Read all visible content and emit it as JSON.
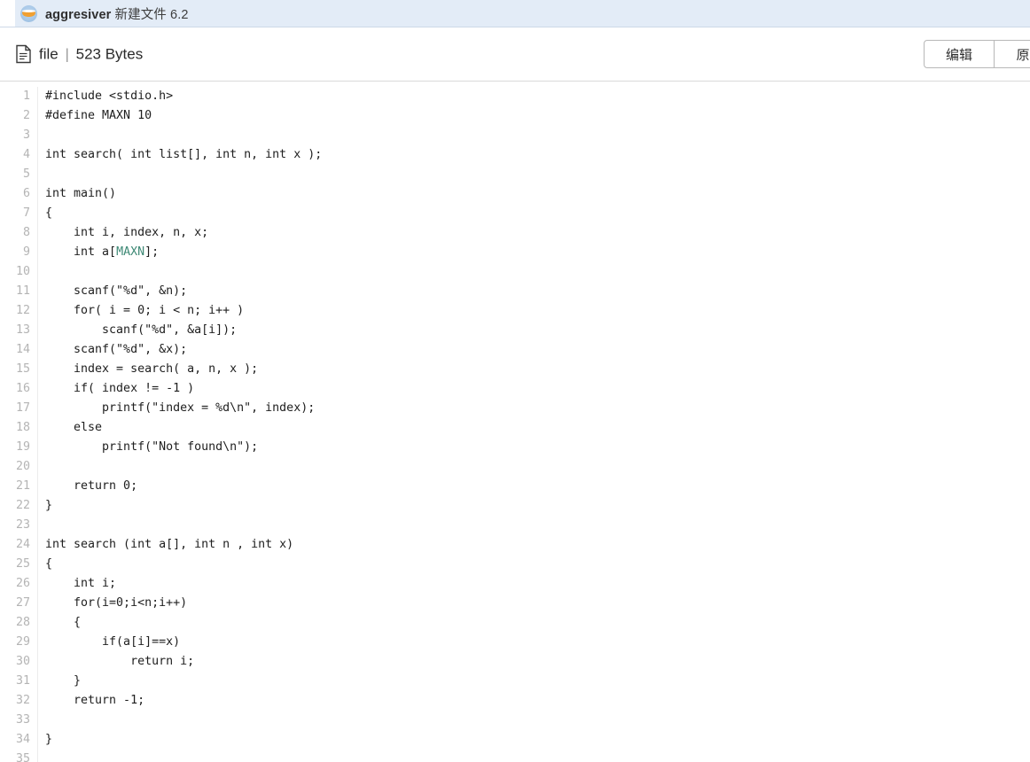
{
  "appbar": {
    "logo_icon": "aggresiver-logo-icon",
    "title_bold": "aggresiver",
    "title_sub": "新建文件 6.2"
  },
  "file_header": {
    "file_icon": "document-icon",
    "name": "file",
    "separator": "|",
    "size": "523 Bytes",
    "buttons": [
      {
        "label": "编辑",
        "name": "edit-button"
      },
      {
        "label": "原始",
        "name": "raw-button"
      }
    ]
  },
  "code": {
    "language": "c",
    "total_lines": 35,
    "lines": [
      {
        "n": "1",
        "text": "#include <stdio.h>"
      },
      {
        "n": "2",
        "text": "#define MAXN 10"
      },
      {
        "n": "3",
        "text": ""
      },
      {
        "n": "4",
        "text": "int search( int list[], int n, int x );"
      },
      {
        "n": "5",
        "text": ""
      },
      {
        "n": "6",
        "text": "int main()"
      },
      {
        "n": "7",
        "text": "{"
      },
      {
        "n": "8",
        "text": "    int i, index, n, x;"
      },
      {
        "n": "9",
        "text": "    int a[MAXN];",
        "macro": "MAXN"
      },
      {
        "n": "10",
        "text": ""
      },
      {
        "n": "11",
        "text": "    scanf(\"%d\", &n);"
      },
      {
        "n": "12",
        "text": "    for( i = 0; i < n; i++ )"
      },
      {
        "n": "13",
        "text": "        scanf(\"%d\", &a[i]);"
      },
      {
        "n": "14",
        "text": "    scanf(\"%d\", &x);"
      },
      {
        "n": "15",
        "text": "    index = search( a, n, x );"
      },
      {
        "n": "16",
        "text": "    if( index != -1 )"
      },
      {
        "n": "17",
        "text": "        printf(\"index = %d\\n\", index);"
      },
      {
        "n": "18",
        "text": "    else"
      },
      {
        "n": "19",
        "text": "        printf(\"Not found\\n\");"
      },
      {
        "n": "20",
        "text": ""
      },
      {
        "n": "21",
        "text": "    return 0;"
      },
      {
        "n": "22",
        "text": "}"
      },
      {
        "n": "23",
        "text": ""
      },
      {
        "n": "24",
        "text": "int search (int a[], int n , int x)"
      },
      {
        "n": "25",
        "text": "{"
      },
      {
        "n": "26",
        "text": "    int i;"
      },
      {
        "n": "27",
        "text": "    for(i=0;i<n;i++)"
      },
      {
        "n": "28",
        "text": "    {"
      },
      {
        "n": "29",
        "text": "        if(a[i]==x)"
      },
      {
        "n": "30",
        "text": "            return i;"
      },
      {
        "n": "31",
        "text": "    }"
      },
      {
        "n": "32",
        "text": "    return -1;"
      },
      {
        "n": "33",
        "text": ""
      },
      {
        "n": "34",
        "text": "}"
      },
      {
        "n": "35",
        "text": ""
      }
    ]
  },
  "colors": {
    "appbar_bg": "#e3ecf7",
    "macro_token": "#3f8a76",
    "line_number": "#b4b4b4",
    "code_text": "#1e1e1e"
  }
}
